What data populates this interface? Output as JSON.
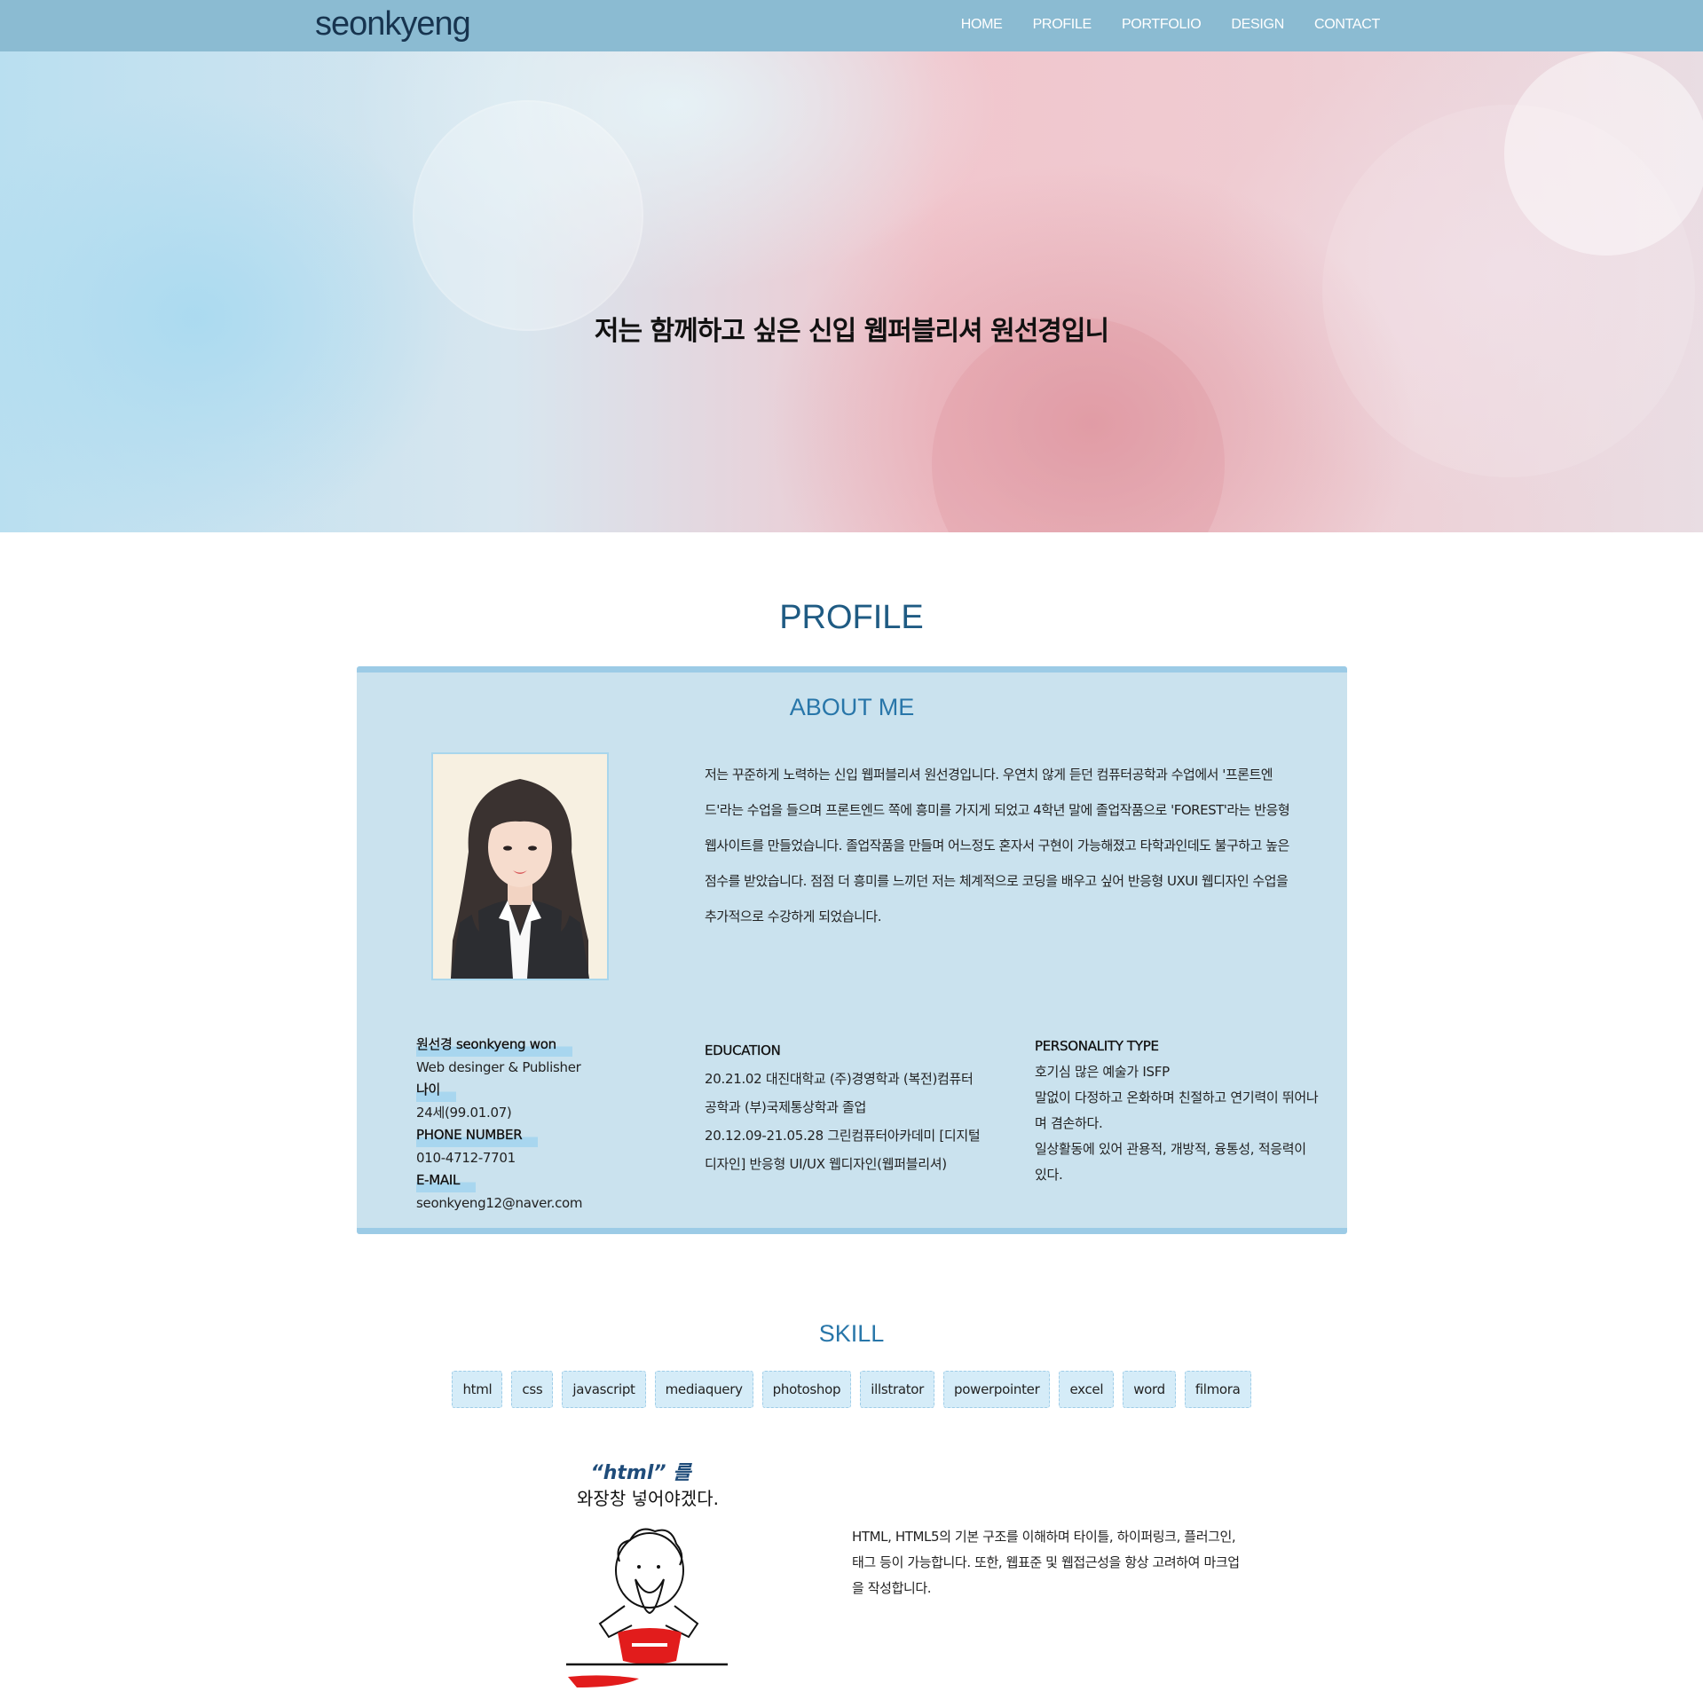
{
  "header": {
    "logo": "seonkyeng",
    "nav": [
      "HOME",
      "PROFILE",
      "PORTFOLIO",
      "DESIGN",
      "CONTACT"
    ]
  },
  "hero": {
    "headline": "저는 함께하고 싶은 신입 웹퍼블리셔 원선경입니"
  },
  "profile": {
    "title": "PROFILE",
    "about_title": "ABOUT ME",
    "about_lines": [
      "저는 꾸준하게 노력하는 신입 웹퍼블리셔 원선경입니다. 우연치 않게 듣던 컴퓨터공학과 수업에서 '프론트엔",
      "드'라는 수업을 들으며 프론트엔드 쪽에 흥미를 가지게 되었고 4학년 말에 졸업작품으로 'FOREST'라는 반응형",
      "웹사이트를 만들었습니다. 졸업작품을 만들며 어느정도 혼자서 구현이 가능해졌고 타학과인데도 불구하고 높은",
      "점수를 받았습니다. 점점 더 흥미를 느끼던 저는 체계적으로 코딩을 배우고 싶어 반응형 UXUI 웹디자인 수업을",
      "추가적으로 수강하게 되었습니다."
    ],
    "info": {
      "name": "원선경 seonkyeng won",
      "role": "Web desinger & Publisher",
      "age_label": "나이",
      "age_value": "24세(99.01.07)",
      "phone_label": "PHONE NUMBER",
      "phone_value": "010-4712-7701",
      "email_label": "E-MAIL",
      "email_value": "seonkyeng12@naver.com"
    },
    "education": {
      "label": "EDUCATION",
      "lines": [
        "20.21.02 대진대학교 (주)경영학과 (복전)컴퓨터",
        "공학과 (부)국제통상학과 졸업",
        "20.12.09-21.05.28 그린컴퓨터아카데미 [디지털",
        "디자인] 반응형 UI/UX 웹디자인(웹퍼블리셔)"
      ]
    },
    "personality": {
      "label": "PERSONALITY TYPE",
      "lines": [
        "호기심 많은 예술가 ISFP",
        "말없이 다정하고 온화하며 친절하고 연기력이 뛰어나",
        "며 겸손하다.",
        "일상활동에 있어 관용적, 개방적, 융통성, 적응력이",
        "있다."
      ]
    }
  },
  "skill": {
    "title": "SKILL",
    "tags": [
      "html",
      "css",
      "javascript",
      "mediaquery",
      "photoshop",
      "illstrator",
      "powerpointer",
      "excel",
      "word",
      "filmora"
    ],
    "cartoon_caption_1": "“html” 를",
    "cartoon_caption_2": "와장창 넣어야겠다.",
    "html_desc": [
      "HTML, HTML5의 기본 구조를 이해하며 타이틀, 하이퍼링크, 플러그인,",
      "태그 등이 가능합니다. 또한, 웹표준 및 웹접근성을 항상 고려하여 마크업",
      "을 작성합니다."
    ]
  }
}
